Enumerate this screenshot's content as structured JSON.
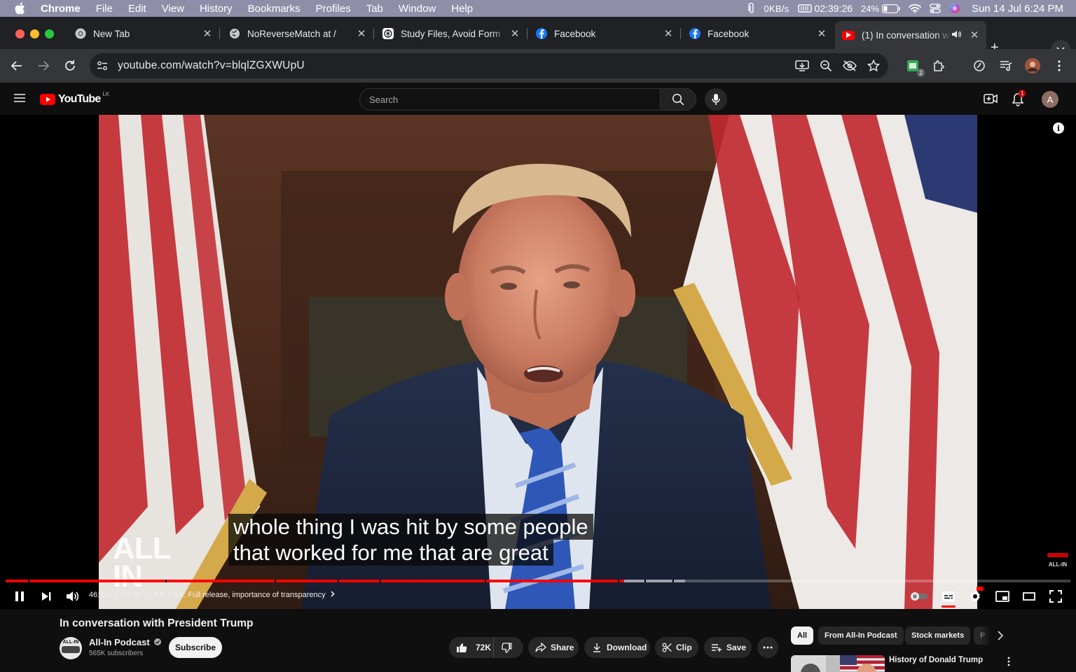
{
  "menubar": {
    "app": "Chrome",
    "items": [
      "File",
      "Edit",
      "View",
      "History",
      "Bookmarks",
      "Profiles",
      "Tab",
      "Window",
      "Help"
    ],
    "net_speed": "0KB/s",
    "timer": "02:39:26",
    "battery": "24%",
    "clock": "Sun 14 Jul  6:24 PM"
  },
  "tabs": [
    {
      "title": "New Tab",
      "favicon": "chrome-icon"
    },
    {
      "title": "NoReverseMatch at /",
      "favicon": "globe-icon"
    },
    {
      "title": "Study Files, Avoid Form",
      "favicon": "chatgpt-icon"
    },
    {
      "title": "Facebook",
      "favicon": "facebook-icon"
    },
    {
      "title": "Facebook",
      "favicon": "facebook-icon"
    },
    {
      "title": "(1) In conversation w",
      "favicon": "youtube-icon",
      "active": true
    }
  ],
  "toolbar": {
    "url": "youtube.com/watch?v=blqlZGXWUpU",
    "extension_badge": "2"
  },
  "youtube": {
    "logo_text": "YouTube",
    "country": "LK",
    "search_placeholder": "Search",
    "notification_count": "1",
    "avatar_letter": "A"
  },
  "player": {
    "caption_line1": "whole thing I was hit by some people",
    "caption_line2": "that worked for me that are great",
    "current_time": "46:50",
    "duration": "1:20:34",
    "chapter": "JFK Files: Full release, importance of transparency",
    "progress_fraction": 0.581,
    "watermark": "ALL IN",
    "corner_brand": "ALL-IN",
    "colors": {
      "progress": "#ff0000",
      "accent": "#ff0000"
    }
  },
  "video": {
    "title": "In conversation with President Trump",
    "channel": "All-In Podcast",
    "channel_avatar_text": "ALL-IN",
    "subscribers": "565K subscribers",
    "subscribe_label": "Subscribe",
    "likes": "72K",
    "share_label": "Share",
    "download_label": "Download",
    "clip_label": "Clip",
    "save_label": "Save"
  },
  "sidebar": {
    "chips": [
      "All",
      "From All-In Podcast",
      "Stock markets",
      "P"
    ],
    "rec_title": "History of Donald Trump"
  }
}
